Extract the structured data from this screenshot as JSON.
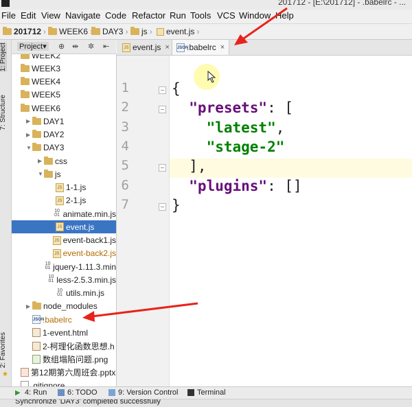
{
  "window": {
    "title": "201712 - [E:\\201712] - .babelrc - ..."
  },
  "menu": [
    "File",
    "Edit",
    "View",
    "Navigate",
    "Code",
    "Refactor",
    "Run",
    "Tools",
    "VCS",
    "Window",
    "Help"
  ],
  "breadcrumb": [
    "201712",
    "WEEK6",
    "DAY3",
    "js",
    "event.js"
  ],
  "left_tools": {
    "project": "1: Project",
    "structure": "7: Structure",
    "favorites": "2: Favorites"
  },
  "project_panel": {
    "dropdown_label": "Project▾",
    "tool_icons": [
      "⊕",
      "⇹",
      "✲",
      "⇤"
    ]
  },
  "tree": [
    {
      "label": "WEEK2",
      "type": "folder",
      "indent": 0
    },
    {
      "label": "WEEK3",
      "type": "folder",
      "indent": 0
    },
    {
      "label": "WEEK4",
      "type": "folder",
      "indent": 0
    },
    {
      "label": "WEEK5",
      "type": "folder",
      "indent": 0
    },
    {
      "label": "WEEK6",
      "type": "folder",
      "indent": 0,
      "expanded": true
    },
    {
      "label": "DAY1",
      "type": "folder",
      "indent": 1,
      "arrow": "▶"
    },
    {
      "label": "DAY2",
      "type": "folder",
      "indent": 1,
      "arrow": "▶"
    },
    {
      "label": "DAY3",
      "type": "folder",
      "indent": 1,
      "arrow": "▼"
    },
    {
      "label": "css",
      "type": "folder",
      "indent": 2,
      "arrow": "▶"
    },
    {
      "label": "js",
      "type": "folder",
      "indent": 2,
      "arrow": "▼"
    },
    {
      "label": "1-1.js",
      "type": "js",
      "indent": 3
    },
    {
      "label": "2-1.js",
      "type": "js",
      "indent": 3
    },
    {
      "label": "animate.min.js",
      "type": "min",
      "indent": 3
    },
    {
      "label": "event.js",
      "type": "js",
      "indent": 3,
      "selected": true
    },
    {
      "label": "event-back1.js",
      "type": "js",
      "indent": 3
    },
    {
      "label": "event-back2.js",
      "type": "js",
      "indent": 3,
      "modified": true
    },
    {
      "label": "jquery-1.11.3.min",
      "type": "min",
      "indent": 3
    },
    {
      "label": "less-2.5.3.min.js",
      "type": "min",
      "indent": 3
    },
    {
      "label": "utils.min.js",
      "type": "min",
      "indent": 3
    },
    {
      "label": "node_modules",
      "type": "folder",
      "indent": 1,
      "arrow": "▶"
    },
    {
      "label": ".babelrc",
      "type": "json",
      "indent": 1,
      "modified": true
    },
    {
      "label": "1-event.html",
      "type": "html",
      "indent": 1
    },
    {
      "label": "2-柯理化函数思想.h",
      "type": "html",
      "indent": 1
    },
    {
      "label": "数组塌陷问题.png",
      "type": "img",
      "indent": 1
    },
    {
      "label": "第12期第六周班会.pptx",
      "type": "ppt",
      "indent": 0
    },
    {
      "label": ".gitignore",
      "type": "file",
      "indent": 0
    }
  ],
  "tabs": [
    {
      "label": "event.js",
      "icon": "js",
      "active": false
    },
    {
      "label": ".babelrc",
      "icon": "json",
      "active": true
    }
  ],
  "editor": {
    "line_numbers": [
      "1",
      "2",
      "3",
      "4",
      "5",
      "6",
      "7"
    ],
    "lines": [
      [
        {
          "c": "pun",
          "t": "{"
        }
      ],
      [
        {
          "c": "key",
          "t": "  \"presets\""
        },
        {
          "c": "pun",
          "t": ": ["
        }
      ],
      [
        {
          "c": "str",
          "t": "    \"latest\""
        },
        {
          "c": "pun",
          "t": ","
        }
      ],
      [
        {
          "c": "str",
          "t": "    \"stage-2\""
        }
      ],
      [
        {
          "c": "pun",
          "t": "  ],"
        }
      ],
      [
        {
          "c": "key",
          "t": "  \"plugins\""
        },
        {
          "c": "pun",
          "t": ": []"
        }
      ],
      [
        {
          "c": "pun",
          "t": "}"
        }
      ]
    ]
  },
  "bottom_tabs": [
    "4: Run",
    "6: TODO",
    "9: Version Control",
    "Terminal"
  ],
  "status": "Synchronize 'DAY3' completed successfully",
  "colors": {
    "selection": "#3a75c4",
    "keyword": "#660e7a",
    "string": "#008000",
    "arrow": "#e8231b"
  }
}
